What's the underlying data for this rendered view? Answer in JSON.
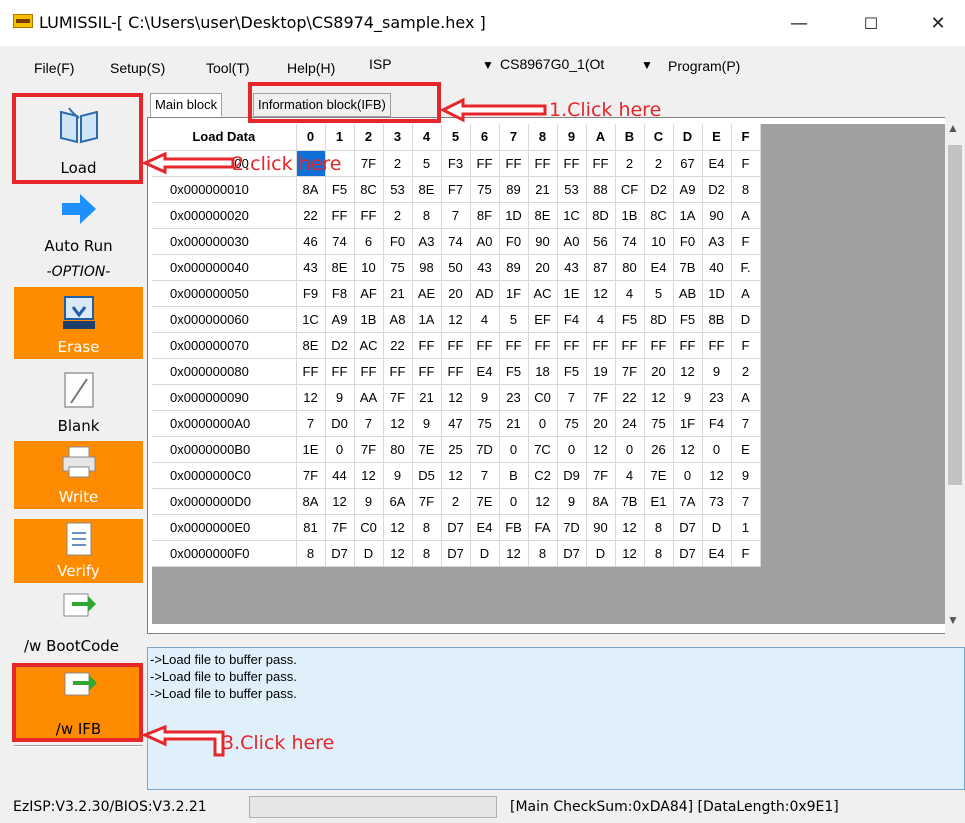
{
  "window": {
    "title": "LUMISSIL-[ C:\\Users\\user\\Desktop\\CS8974_sample.hex ]",
    "minimize": "—",
    "maximize": "☐",
    "close": "✕"
  },
  "menu": {
    "file": "File(F)",
    "setup": "Setup(S)",
    "tool": "Tool(T)",
    "help": "Help(H)",
    "isp": "ISP",
    "chip": "CS8967G0_1(Ot",
    "program": "Program(P)"
  },
  "sidebar": {
    "load": "Load",
    "auto_run": "Auto Run",
    "option": "-OPTION-",
    "erase": "Erase",
    "blank": "Blank",
    "write": "Write",
    "verify": "Verify",
    "bootcode": "/w BootCode",
    "ifb": "/w IFB",
    "orange": "#ff8c00"
  },
  "tabs": {
    "main": "Main block",
    "ifb": "Information block(IFB)"
  },
  "grid": {
    "header_label": "Load Data",
    "columns": [
      "0",
      "1",
      "2",
      "3",
      "4",
      "5",
      "6",
      "7",
      "8",
      "9",
      "A",
      "B",
      "C",
      "D",
      "E",
      "F"
    ],
    "rows": [
      {
        "addr": "0x000000000",
        "cells": [
          "",
          "",
          "7F",
          "2",
          "5",
          "F3",
          "FF",
          "FF",
          "FF",
          "FF",
          "FF",
          "2",
          "2",
          "67",
          "E4",
          "F"
        ]
      },
      {
        "addr": "0x000000010",
        "cells": [
          "8A",
          "F5",
          "8C",
          "53",
          "8E",
          "F7",
          "75",
          "89",
          "21",
          "53",
          "88",
          "CF",
          "D2",
          "A9",
          "D2",
          "8"
        ]
      },
      {
        "addr": "0x000000020",
        "cells": [
          "22",
          "FF",
          "FF",
          "2",
          "8",
          "7",
          "8F",
          "1D",
          "8E",
          "1C",
          "8D",
          "1B",
          "8C",
          "1A",
          "90",
          "A"
        ]
      },
      {
        "addr": "0x000000030",
        "cells": [
          "46",
          "74",
          "6",
          "F0",
          "A3",
          "74",
          "A0",
          "F0",
          "90",
          "A0",
          "56",
          "74",
          "10",
          "F0",
          "A3",
          "F"
        ]
      },
      {
        "addr": "0x000000040",
        "cells": [
          "43",
          "8E",
          "10",
          "75",
          "98",
          "50",
          "43",
          "89",
          "20",
          "43",
          "87",
          "80",
          "E4",
          "7B",
          "40",
          "F."
        ]
      },
      {
        "addr": "0x000000050",
        "cells": [
          "F9",
          "F8",
          "AF",
          "21",
          "AE",
          "20",
          "AD",
          "1F",
          "AC",
          "1E",
          "12",
          "4",
          "5",
          "AB",
          "1D",
          "A"
        ]
      },
      {
        "addr": "0x000000060",
        "cells": [
          "1C",
          "A9",
          "1B",
          "A8",
          "1A",
          "12",
          "4",
          "5",
          "EF",
          "F4",
          "4",
          "F5",
          "8D",
          "F5",
          "8B",
          "D"
        ]
      },
      {
        "addr": "0x000000070",
        "cells": [
          "8E",
          "D2",
          "AC",
          "22",
          "FF",
          "FF",
          "FF",
          "FF",
          "FF",
          "FF",
          "FF",
          "FF",
          "FF",
          "FF",
          "FF",
          "F"
        ]
      },
      {
        "addr": "0x000000080",
        "cells": [
          "FF",
          "FF",
          "FF",
          "FF",
          "FF",
          "FF",
          "E4",
          "F5",
          "18",
          "F5",
          "19",
          "7F",
          "20",
          "12",
          "9",
          "2"
        ]
      },
      {
        "addr": "0x000000090",
        "cells": [
          "12",
          "9",
          "AA",
          "7F",
          "21",
          "12",
          "9",
          "23",
          "C0",
          "7",
          "7F",
          "22",
          "12",
          "9",
          "23",
          "A"
        ]
      },
      {
        "addr": "0x0000000A0",
        "cells": [
          "7",
          "D0",
          "7",
          "12",
          "9",
          "47",
          "75",
          "21",
          "0",
          "75",
          "20",
          "24",
          "75",
          "1F",
          "F4",
          "7"
        ]
      },
      {
        "addr": "0x0000000B0",
        "cells": [
          "1E",
          "0",
          "7F",
          "80",
          "7E",
          "25",
          "7D",
          "0",
          "7C",
          "0",
          "12",
          "0",
          "26",
          "12",
          "0",
          "E"
        ]
      },
      {
        "addr": "0x0000000C0",
        "cells": [
          "7F",
          "44",
          "12",
          "9",
          "D5",
          "12",
          "7",
          "B",
          "C2",
          "D9",
          "7F",
          "4",
          "7E",
          "0",
          "12",
          "9"
        ]
      },
      {
        "addr": "0x0000000D0",
        "cells": [
          "8A",
          "12",
          "9",
          "6A",
          "7F",
          "2",
          "7E",
          "0",
          "12",
          "9",
          "8A",
          "7B",
          "E1",
          "7A",
          "73",
          "7"
        ]
      },
      {
        "addr": "0x0000000E0",
        "cells": [
          "81",
          "7F",
          "C0",
          "12",
          "8",
          "D7",
          "E4",
          "FB",
          "FA",
          "7D",
          "90",
          "12",
          "8",
          "D7",
          "D",
          "1"
        ]
      },
      {
        "addr": "0x0000000F0",
        "cells": [
          "8",
          "D7",
          "D",
          "12",
          "8",
          "D7",
          "D",
          "12",
          "8",
          "D7",
          "D",
          "12",
          "8",
          "D7",
          "E4",
          "F"
        ]
      }
    ]
  },
  "log": {
    "lines": [
      "->Load file to buffer pass.",
      "->Load file to buffer pass.",
      "->Load file to buffer pass."
    ]
  },
  "status": {
    "version": "EzISP:V3.2.30/BIOS:V3.2.21",
    "checksum": "[Main CheckSum:0xDA84]  [DataLength:0x9E1]"
  },
  "annotations": {
    "step1": "1.Click here",
    "step2": "2.click here",
    "step3": "3.Click here",
    "color": "#e6262b"
  }
}
